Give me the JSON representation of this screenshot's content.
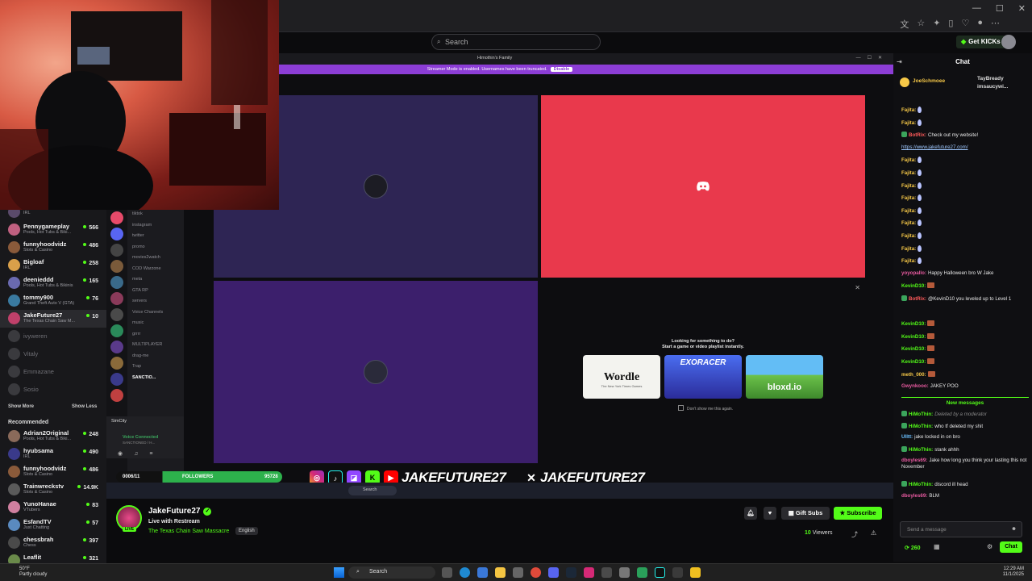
{
  "header": {
    "search_placeholder": "Search",
    "get_kicks": "Get KICKs"
  },
  "discord": {
    "window_title": "Himothin's Family",
    "streamer_banner": "Streamer Mode is enabled. Usernames have been truncated.",
    "disable_label": "Disable",
    "channels": [
      "tiktok",
      "instagram",
      "twitter",
      "promo",
      "movies2watch",
      "COD Warzone",
      "meta",
      "GTA RP",
      "servers",
      "Voice Channels",
      "music",
      "grrrr",
      "MULTIPLAYER",
      "drag-me",
      "Trap",
      "SANCTIO..."
    ],
    "activity_title": "Looking for something to do?",
    "activity_subtitle": "Start a game or video playlist instantly.",
    "activities": [
      "Wordle",
      "EXORACER",
      "bloxd.io"
    ],
    "wordle_subtitle": "The New York Times Games",
    "dont_show": "Don't show me this again.",
    "voice_user": "SimCity",
    "voice_status": "Voice Connected",
    "voice_sub": "SANCTIONED / H..."
  },
  "overlay": {
    "followers_label": "FOLLOWERS",
    "followers_count": "0006/11",
    "followers_goal": "95728",
    "handle_1": "JAKEFUTURE27",
    "handle_2": "JAKEFUTURE27_",
    "inner_search": "Search"
  },
  "sidebar": {
    "following": [
      {
        "name": "Pennygameplay",
        "category": "Pools, Hot Tubs & Biki...",
        "viewers": "566",
        "color": "#c06080"
      },
      {
        "name": "funnyhoodvidz",
        "category": "Slots & Casino",
        "viewers": "486",
        "color": "#8a5a3a"
      },
      {
        "name": "Bigloaf",
        "category": "IRL",
        "viewers": "258",
        "color": "#d9a04a"
      },
      {
        "name": "deenieddd",
        "category": "Pools, Hot Tubs & Bikinis",
        "viewers": "165",
        "color": "#6a6ab0"
      },
      {
        "name": "tommy900",
        "category": "Grand Theft Auto V (GTA)",
        "viewers": "76",
        "color": "#3a7aa0"
      },
      {
        "name": "JakeFuture27",
        "category": "The Texas Chain Saw M...",
        "viewers": "10",
        "color": "#c0406a"
      }
    ],
    "offline": [
      "ivyweren",
      "Vitaly",
      "Emmazane",
      "Sosio"
    ],
    "show_more": "Show More",
    "show_less": "Show Less",
    "recommended_label": "Recommended",
    "recommended": [
      {
        "name": "Adrian2Original",
        "category": "Pools, Hot Tubs & Biki...",
        "viewers": "248",
        "color": "#8a6a5a"
      },
      {
        "name": "hyubsama",
        "category": "IRL",
        "viewers": "490",
        "color": "#3a3a8a"
      },
      {
        "name": "funnyhoodvidz",
        "category": "Slots & Casino",
        "viewers": "486",
        "color": "#8a5a3a"
      },
      {
        "name": "Trainwreckstv",
        "category": "Slots & Casino",
        "viewers": "14.9K",
        "color": "#5a5a5a"
      },
      {
        "name": "YunoHanae",
        "category": "VTubers",
        "viewers": "83",
        "color": "#d080a0"
      },
      {
        "name": "EsfandTV",
        "category": "Just Chatting",
        "viewers": "57",
        "color": "#5a8ac0"
      },
      {
        "name": "chessbrah",
        "category": "Chess",
        "viewers": "397",
        "color": "#4a4a4a"
      },
      {
        "name": "Leaflit",
        "category": "",
        "viewers": "321",
        "color": "#6a8a4a"
      }
    ]
  },
  "stream": {
    "name": "JakeFuture27",
    "title": "Live with Restream",
    "category": "The Texas Chain Saw Massacre",
    "language": "English",
    "live": "LIVE",
    "gift_subs": "Gift Subs",
    "subscribe": "Subscribe",
    "viewers_count": "10",
    "viewers_label": "Viewers"
  },
  "chat": {
    "title": "Chat",
    "pinned_user": "JoeSchmoee",
    "pinned_others": [
      "TayBready",
      "imsaucywi..."
    ],
    "messages": [
      {
        "user": "Fajita:",
        "text": "",
        "color": "#f7c948",
        "emote": "drop"
      },
      {
        "user": "Fajita:",
        "text": "",
        "color": "#f7c948",
        "emote": "drop"
      },
      {
        "user": "BotRix:",
        "text": "Check out my website!",
        "color": "#ff5a5a",
        "badge": true
      },
      {
        "user": "",
        "text": "https://www.jakefuture27.com/",
        "color": "#fff",
        "link": true
      },
      {
        "user": "Fajita:",
        "text": "",
        "color": "#f7c948",
        "emote": "drop"
      },
      {
        "user": "Fajita:",
        "text": "",
        "color": "#f7c948",
        "emote": "drop"
      },
      {
        "user": "Fajita:",
        "text": "",
        "color": "#f7c948",
        "emote": "drop"
      },
      {
        "user": "Fajita:",
        "text": "",
        "color": "#f7c948",
        "emote": "drop"
      },
      {
        "user": "Fajita:",
        "text": "",
        "color": "#f7c948",
        "emote": "drop"
      },
      {
        "user": "Fajita:",
        "text": "",
        "color": "#f7c948",
        "emote": "drop"
      },
      {
        "user": "Fajita:",
        "text": "",
        "color": "#f7c948",
        "emote": "drop"
      },
      {
        "user": "Fajita:",
        "text": "",
        "color": "#f7c948",
        "emote": "drop"
      },
      {
        "user": "Fajita:",
        "text": "",
        "color": "#f7c948",
        "emote": "drop"
      },
      {
        "user": "yoyopallo:",
        "text": "Happy Halloween bro W Jake",
        "color": "#e85aa0"
      },
      {
        "user": "KevinD10:",
        "text": "",
        "color": "#53fc18",
        "emote": "face"
      },
      {
        "user": "BotRix:",
        "text": "@KevinD10 you leveled up to Level 1",
        "color": "#ff5a5a",
        "badge": true
      },
      {
        "user": "KevinD10:",
        "text": "",
        "color": "#53fc18",
        "emote": "face"
      },
      {
        "user": "KevinD10:",
        "text": "",
        "color": "#53fc18",
        "emote": "face"
      },
      {
        "user": "KevinD10:",
        "text": "",
        "color": "#53fc18",
        "emote": "face"
      },
      {
        "user": "KevinD10:",
        "text": "",
        "color": "#53fc18",
        "emote": "face"
      },
      {
        "user": "meth_000:",
        "text": "",
        "color": "#f7c948",
        "emote": "face"
      },
      {
        "user": "Gwynkooo:",
        "text": "JAKEY POO",
        "color": "#e85aa0"
      }
    ],
    "new_messages_label": "New messages",
    "new_messages": [
      {
        "user": "HiMoThin:",
        "text": "Deleted by a moderator",
        "color": "#53fc18",
        "badge": true,
        "muted": true
      },
      {
        "user": "HiMoThin:",
        "text": "who tf deleted my shit",
        "color": "#53fc18",
        "badge": true
      },
      {
        "user": "Ulltt:",
        "text": "jake locked in on bro",
        "color": "#6ac0ff"
      },
      {
        "user": "HiMoThin:",
        "text": "stank ahhh",
        "color": "#53fc18",
        "badge": true
      },
      {
        "user": "dboyles69:",
        "text": "Jake how long you think your lasting this not November",
        "color": "#e85aa0"
      },
      {
        "user": "HiMoThin:",
        "text": "discord ill head",
        "color": "#53fc18",
        "badge": true
      },
      {
        "user": "dboyles69:",
        "text": "BLM",
        "color": "#e85aa0"
      }
    ],
    "input_placeholder": "Send a message",
    "points": "260",
    "send_label": "Chat"
  },
  "taskbar": {
    "temperature": "50°F",
    "weather": "Partly cloudy",
    "search": "Search",
    "time": "12:29 AM",
    "date": "11/1/2025"
  }
}
